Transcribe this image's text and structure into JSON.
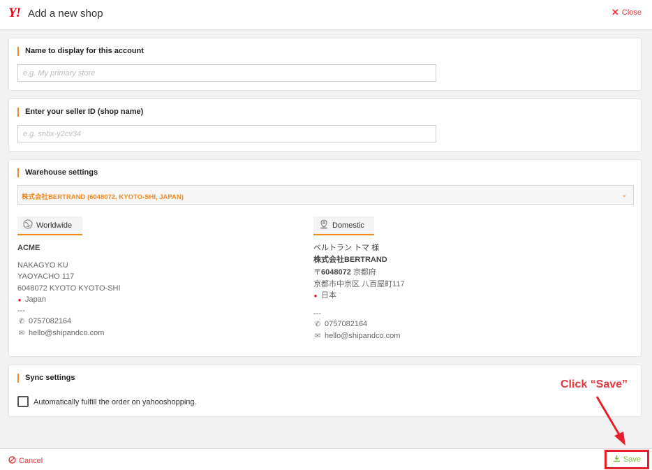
{
  "header": {
    "logo": "Y!",
    "title": "Add a new shop",
    "close_label": "Close"
  },
  "name_section": {
    "title": "Name to display for this account",
    "placeholder": "e.g. My primary store",
    "value": ""
  },
  "seller_section": {
    "title": "Enter your seller ID (shop name)",
    "placeholder": "e.g. snbx-y2cv34",
    "value": ""
  },
  "warehouse": {
    "title": "Warehouse settings",
    "selected": "株式会社BERTRAND (6048072, KYOTO-SHI, JAPAN)",
    "worldwide": {
      "tab_label": "Worldwide",
      "company": "ACME",
      "line1": "NAKAGYO KU",
      "line2": "YAOYACHO 117",
      "line3": "6048072 KYOTO KYOTO-SHI",
      "country": "Japan",
      "separator": "---",
      "phone": "0757082164",
      "email": "hello@shipandco.com"
    },
    "domestic": {
      "tab_label": "Domestic",
      "name": "ベルトラン トマ 様",
      "company": "株式会社BERTRAND",
      "postal_prefix": "〒",
      "postal": "6048072",
      "prefecture": " 京都府",
      "line2": "京都市中京区 八百屋町117",
      "country": "日本",
      "separator": "---",
      "phone": "0757082164",
      "email": "hello@shipandco.com"
    }
  },
  "sync": {
    "title": "Sync settings",
    "checkbox_label": "Automatically fulfill the order on yahooshopping.",
    "checked": false
  },
  "annotation": "Click “Save”",
  "footer": {
    "cancel_label": "Cancel",
    "save_label": "Save"
  },
  "colors": {
    "accent": "#f08a24",
    "danger": "#e5373b",
    "save_green": "#7cbf3f",
    "highlight": "#e5202a"
  },
  "icons": {
    "close": "x-icon",
    "cancel": "ban-icon",
    "save": "download-icon",
    "worldwide": "globe-icon",
    "domestic": "map-pin-icon",
    "phone": "phone-icon",
    "email": "mail-icon",
    "chevron": "chevron-down-icon"
  }
}
